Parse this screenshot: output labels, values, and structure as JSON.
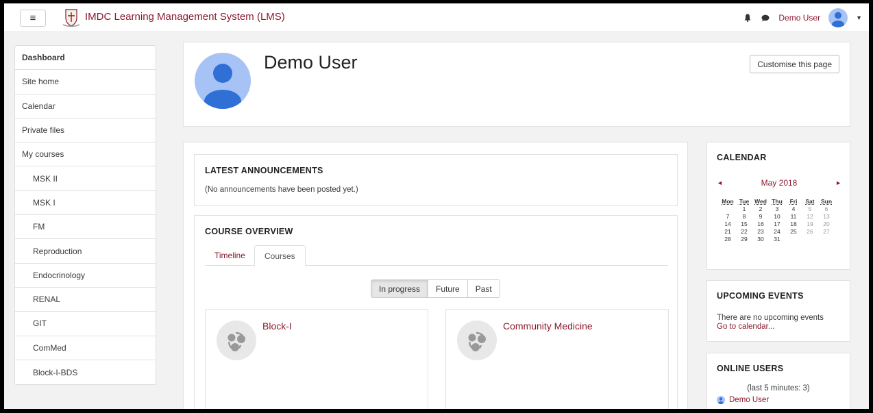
{
  "navbar": {
    "menu_icon": "hamburger-icon",
    "site_title": "IMDC Learning Management System (LMS)",
    "user_name": "Demo User",
    "bell_icon": "bell-icon",
    "message_icon": "chat-bubble-icon"
  },
  "sidebar": {
    "items": [
      {
        "label": "Dashboard",
        "active": true
      },
      {
        "label": "Site home"
      },
      {
        "label": "Calendar"
      },
      {
        "label": "Private files"
      },
      {
        "label": "My courses"
      },
      {
        "label": "MSK II",
        "sub": true
      },
      {
        "label": "MSK I",
        "sub": true
      },
      {
        "label": "FM",
        "sub": true
      },
      {
        "label": "Reproduction",
        "sub": true
      },
      {
        "label": "Endocrinology",
        "sub": true
      },
      {
        "label": "RENAL",
        "sub": true
      },
      {
        "label": "GIT",
        "sub": true
      },
      {
        "label": "ComMed",
        "sub": true
      },
      {
        "label": "Block-I-BDS",
        "sub": true
      }
    ]
  },
  "header": {
    "title": "Demo User",
    "customise_label": "Customise this page"
  },
  "announcements": {
    "title": "LATEST ANNOUNCEMENTS",
    "text": "(No announcements have been posted yet.)"
  },
  "overview": {
    "title": "COURSE OVERVIEW",
    "tabs": [
      "Timeline",
      "Courses"
    ],
    "filters": [
      "In progress",
      "Future",
      "Past"
    ],
    "courses": [
      "Block-I",
      "Community Medicine"
    ]
  },
  "calendar": {
    "title": "CALENDAR",
    "month": "May 2018",
    "prev": "◄",
    "next": "►",
    "weekdays": [
      "Mon",
      "Tue",
      "Wed",
      "Thu",
      "Fri",
      "Sat",
      "Sun"
    ],
    "weeks": [
      [
        "",
        "1",
        "2",
        "3",
        "4",
        "5",
        "6"
      ],
      [
        "7",
        "8",
        "9",
        "10",
        "11",
        "12",
        "13"
      ],
      [
        "14",
        "15",
        "16",
        "17",
        "18",
        "19",
        "20"
      ],
      [
        "21",
        "22",
        "23",
        "24",
        "25",
        "26",
        "27"
      ],
      [
        "28",
        "29",
        "30",
        "31",
        "",
        "",
        ""
      ]
    ]
  },
  "upcoming": {
    "title": "UPCOMING EVENTS",
    "text": "There are no upcoming events",
    "link": "Go to calendar..."
  },
  "online": {
    "title": "ONLINE USERS",
    "meta": "(last 5 minutes: 3)",
    "users": [
      "Demo User"
    ]
  },
  "colors": {
    "brand": "#8b1a2e",
    "avatar": "#a7c3f5"
  }
}
